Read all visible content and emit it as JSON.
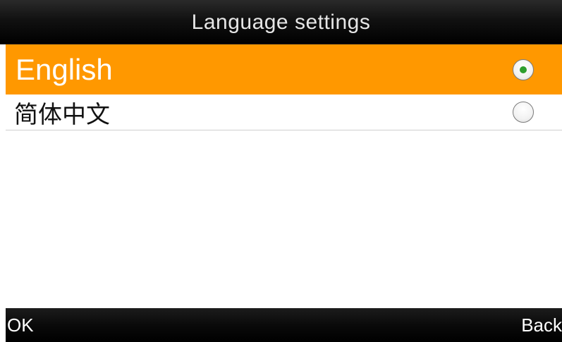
{
  "title_bar": {
    "title": "Language settings"
  },
  "languages": [
    {
      "label": "English",
      "selected": true
    },
    {
      "label": "简体中文",
      "selected": false
    }
  ],
  "softkeys": {
    "left": "OK",
    "right": "Back"
  },
  "colors": {
    "selected_row": "#ff9800",
    "title_bar": "#000000",
    "radio_dot": "#2e9e2e"
  },
  "icons": {
    "radio_selected": "radio-selected-icon",
    "radio_unselected": "radio-unselected-icon"
  }
}
